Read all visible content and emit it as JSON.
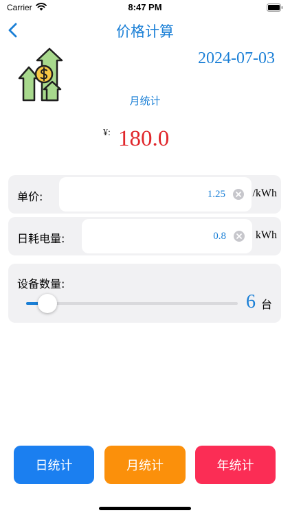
{
  "status_bar": {
    "carrier": "Carrier",
    "time": "8:47 PM"
  },
  "nav": {
    "title": "价格计算",
    "back_icon": "chevron-left-icon"
  },
  "illustration_icon": "house-dollar-arrow-icon",
  "date": "2024-07-03",
  "period_label": "月统计",
  "total": {
    "currency": "¥:",
    "value": "180.0"
  },
  "unit_price": {
    "label": "单价:",
    "value": "1.25",
    "unit": "/kWh"
  },
  "daily_usage": {
    "label": "日耗电量:",
    "value": "0.8",
    "unit": "kWh"
  },
  "device_count": {
    "label": "设备数量:",
    "value": "6",
    "unit": "台",
    "slider_fraction": 0.1
  },
  "buttons": {
    "day": "日统计",
    "month": "月统计",
    "year": "年统计"
  },
  "colors": {
    "accent_blue": "#1a7fd6",
    "total_red": "#e0262b",
    "button_day": "#1b7ff0",
    "button_month": "#fb900b",
    "button_year": "#fb2d55"
  }
}
